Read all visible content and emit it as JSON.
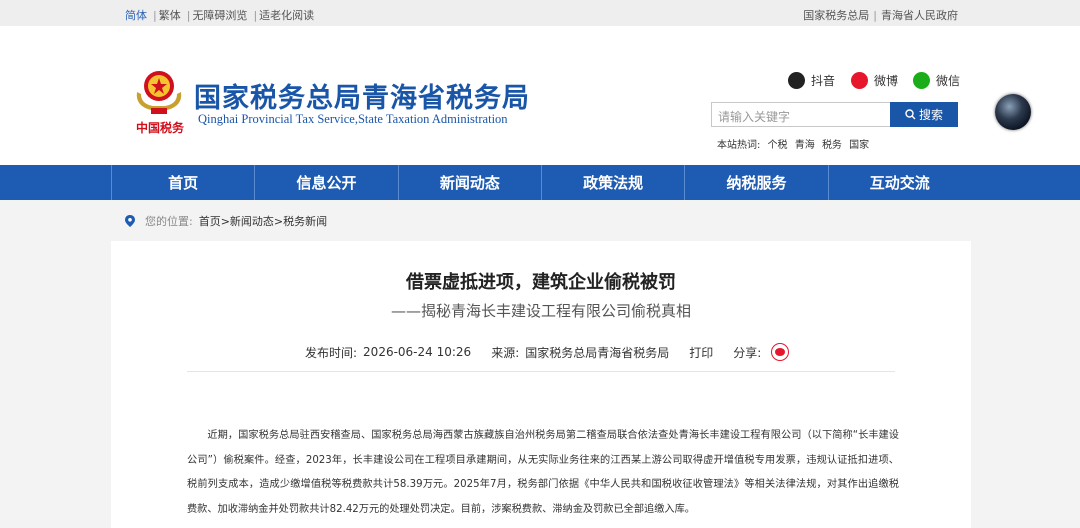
{
  "topbar": {
    "lang_simplified": "简体",
    "lang_traditional": "繁体",
    "accessible": "无障碍浏览",
    "elderly": "适老化阅读",
    "link_sat": "国家税务总局",
    "link_gov": "青海省人民政府"
  },
  "header": {
    "emblem_text": "中国税务",
    "title": "国家税务总局青海省税务局",
    "subtitle": "Qinghai Provincial Tax Service,State Taxation Administration",
    "social": {
      "douyin": "抖音",
      "weibo": "微博",
      "weixin": "微信"
    },
    "search": {
      "placeholder": "请输入关键字",
      "button": "搜索"
    },
    "hot_label": "本站热词:",
    "hot_words": [
      "个税",
      "青海",
      "税务",
      "国家"
    ]
  },
  "nav": {
    "items": [
      "首页",
      "信息公开",
      "新闻动态",
      "政策法规",
      "纳税服务",
      "互动交流"
    ]
  },
  "breadcrumb": {
    "label": "您的位置:",
    "path": "首页>新闻动态>税务新闻"
  },
  "article": {
    "title": "借票虚抵进项，建筑企业偷税被罚",
    "subtitle": "——揭秘青海长丰建设工程有限公司偷税真相",
    "publish_label": "发布时间:",
    "publish_time": "2026-06-24 10:26",
    "source_label": "来源:",
    "source": "国家税务总局青海省税务局",
    "print": "打印",
    "share": "分享:",
    "body": "近期，国家税务总局驻西安稽查局、国家税务总局海西蒙古族藏族自治州税务局第二稽查局联合依法查处青海长丰建设工程有限公司（以下简称“长丰建设公司”）偷税案件。经查，2023年，长丰建设公司在工程项目承建期间，从无实际业务往来的江西某上游公司取得虚开增值税专用发票，违规认证抵扣进项、税前列支成本，造成少缴增值税等税费款共计58.39万元。2025年7月，税务部门依据《中华人民共和国税收征收管理法》等相关法律法规，对其作出追缴税费款、加收滞纳金并处罚款共计82.42万元的处理处罚决定。目前，涉案税费款、滞纳金及罚款已全部追缴入库。"
  },
  "colors": {
    "brand_blue": "#1e5cb3",
    "weibo_red": "#e6162d",
    "weixin_green": "#1aad19"
  }
}
